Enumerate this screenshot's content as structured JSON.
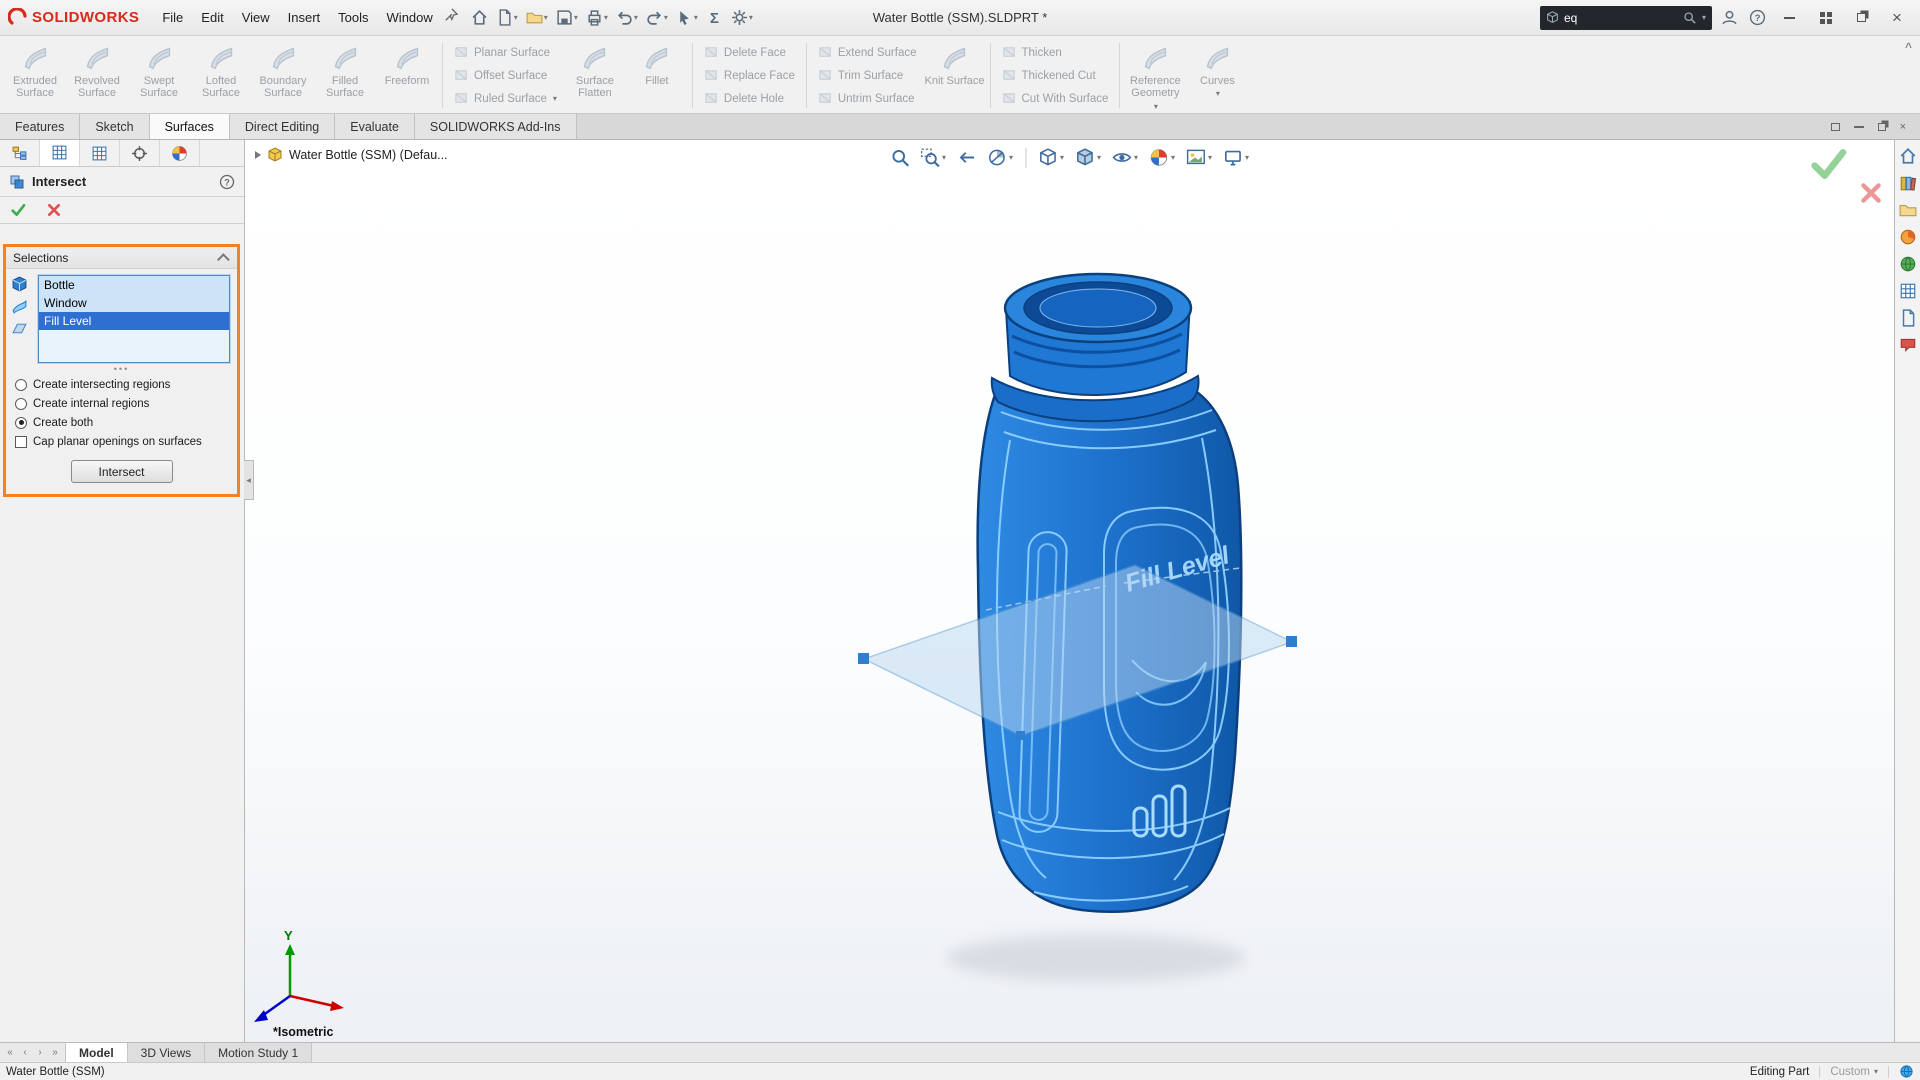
{
  "colors": {
    "callout_orange": "#F5821F",
    "selection_highlight": "#2F6FD1",
    "selection_highlight_light": "#CDE3F7",
    "bottle_blue": "#1F74CF",
    "bottle_edge_blue": "#0B3F7E",
    "bottle_line_blue": "#8FD0FF",
    "confirm_green": "#3FAE49",
    "cancel_red": "#E05252",
    "logo_red": "#D62A1E"
  },
  "titlebar": {
    "app_logo": "SOLIDWORKS",
    "menus": [
      "File",
      "Edit",
      "View",
      "Insert",
      "Tools",
      "Window"
    ],
    "document_title": "Water Bottle (SSM).SLDPRT *",
    "search": {
      "value": "eq"
    }
  },
  "ribbon": {
    "large_buttons": [
      "Extruded Surface",
      "Revolved Surface",
      "Swept Surface",
      "Lofted Surface",
      "Boundary Surface",
      "Filled Surface",
      "Freeform"
    ],
    "group_planar": [
      "Planar Surface",
      "Offset Surface",
      "Ruled Surface"
    ],
    "mid_buttons_1": [
      "Surface Flatten",
      "Fillet"
    ],
    "group_delete": [
      "Delete Face",
      "Replace Face",
      "Delete Hole"
    ],
    "group_extend": [
      "Extend Surface",
      "Trim Surface",
      "Untrim Surface"
    ],
    "knit": "Knit Surface",
    "group_thicken": [
      "Thicken",
      "Thickened Cut",
      "Cut With Surface"
    ],
    "reference_geometry": "Reference Geometry",
    "curves": "Curves"
  },
  "command_tabs": {
    "items": [
      "Features",
      "Sketch",
      "Surfaces",
      "Direct Editing",
      "Evaluate",
      "SOLIDWORKS Add-Ins"
    ],
    "active": "Surfaces"
  },
  "property_manager": {
    "title": "Intersect",
    "selections": {
      "header": "Selections",
      "list_items": [
        "Bottle",
        "Window",
        "Fill Level"
      ],
      "focused_item": "Fill Level",
      "radio_options": [
        "Create intersecting regions",
        "Create internal regions",
        "Create both"
      ],
      "selected_radio": "Create both",
      "checkbox_label": "Cap planar openings on surfaces",
      "checkbox_checked": false,
      "apply_button": "Intersect"
    }
  },
  "feature_tree": {
    "root_node": "Water Bottle (SSM) (Defau..."
  },
  "viewport": {
    "orientation_label": "*Isometric",
    "model_label": "Fill Level",
    "triad_y_label": "Y"
  },
  "document_tabs": {
    "items": [
      "Model",
      "3D Views",
      "Motion Study 1"
    ],
    "active": "Model"
  },
  "status_bar": {
    "document_name": "Water Bottle (SSM)",
    "mode": "Editing Part",
    "units": "Custom"
  },
  "icons": {
    "search": "magnifier",
    "help": "question-circle",
    "user": "person-circle",
    "confirm": "green-check",
    "cancel": "red-x",
    "pin": "pushpin",
    "section_plane_handles": "blue-squares"
  }
}
